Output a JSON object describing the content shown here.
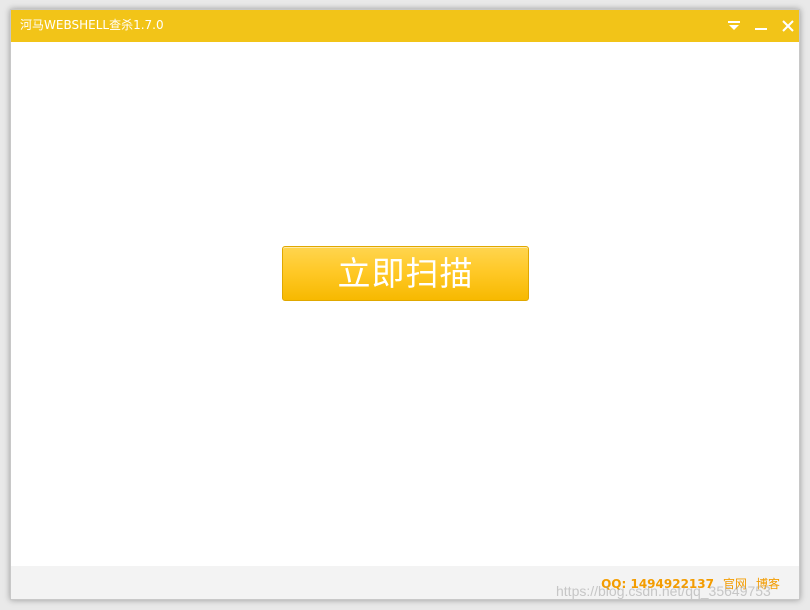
{
  "window": {
    "title": "河马WEBSHELL查杀1.7.0"
  },
  "titlebar": {
    "accent_color": "#f2c418",
    "controls": [
      {
        "name": "menu-dropdown-icon"
      },
      {
        "name": "minimize-icon"
      },
      {
        "name": "close-icon"
      }
    ]
  },
  "main": {
    "scan_button_label": "立即扫描",
    "scan_button_color": "#ffc928"
  },
  "footer": {
    "qq_text": "QQ: 1494922137",
    "official_site_label": "官网",
    "blog_label": "博客",
    "link_color": "#f39c00"
  },
  "watermark": {
    "text": "https://blog.csdn.net/qq_35649753"
  }
}
